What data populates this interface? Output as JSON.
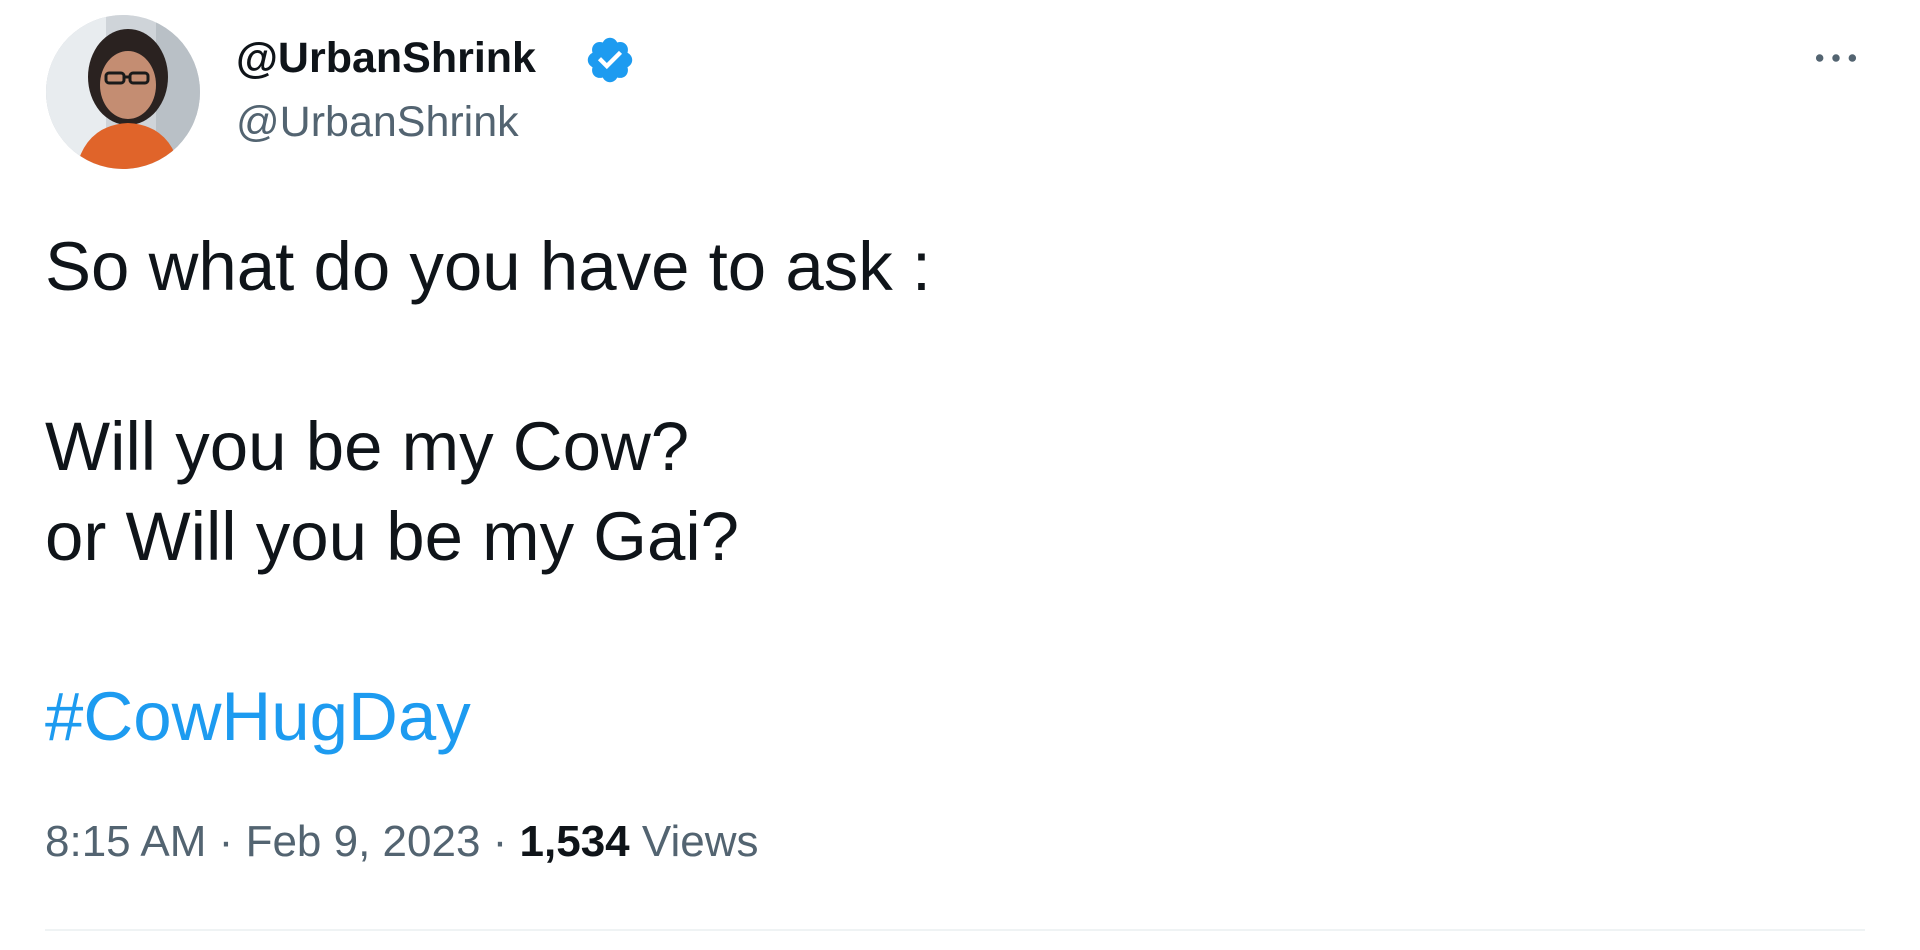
{
  "author": {
    "display_name": "@UrbanShrink",
    "handle": "@UrbanShrink",
    "verified": true,
    "avatar_icon": "profile-photo"
  },
  "tweet": {
    "lines": [
      "So what do you have to ask :",
      "Will you be my Cow?",
      "or Will you be my Gai?"
    ],
    "hashtag": "#CowHugDay"
  },
  "meta": {
    "time": "8:15 AM",
    "separator": "·",
    "date": "Feb 9, 2023",
    "views_count": "1,534",
    "views_label": "Views"
  },
  "colors": {
    "link": "#1d9bf0",
    "secondary_text": "#536471",
    "primary_text": "#0f1419"
  }
}
